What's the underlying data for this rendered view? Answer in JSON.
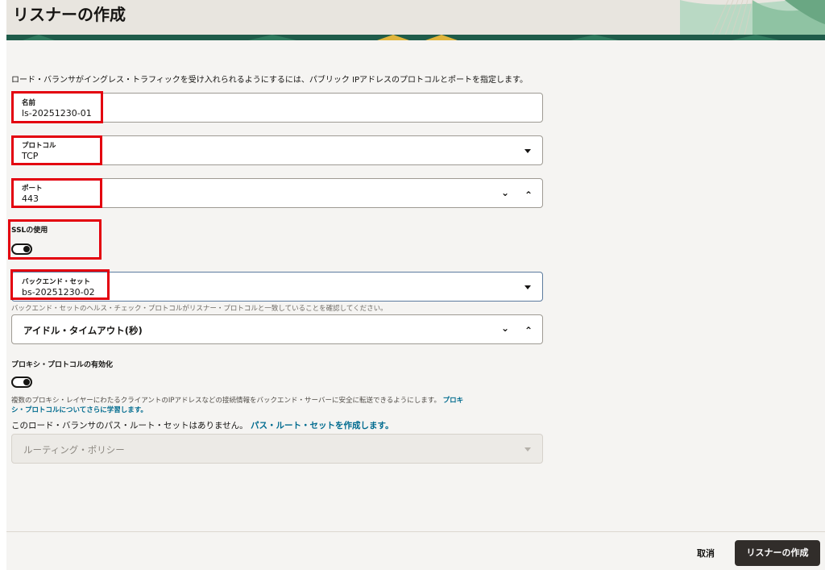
{
  "header": {
    "title": "リスナーの作成"
  },
  "intro": "ロード・バランサがイングレス・トラフィックを受け入れられるようにするには、パブリック IPアドレスのプロトコルとポートを指定します。",
  "form": {
    "name": {
      "label": "名前",
      "value": "ls-20251230-01"
    },
    "protocol": {
      "label": "プロトコル",
      "value": "TCP"
    },
    "port": {
      "label": "ポート",
      "value": "443"
    },
    "ssl": {
      "label": "SSLの使用",
      "enabled": false
    },
    "backend_set": {
      "label": "バックエンド・セット",
      "value": "bs-20251230-02",
      "helper": "バックエンド・セットのヘルス・チェック・プロトコルがリスナー・プロトコルと一致していることを確認してください。"
    },
    "idle_timeout": {
      "placeholder": "アイドル・タイムアウト(秒)"
    },
    "proxy_protocol": {
      "label": "プロキシ・プロトコルの有効化",
      "enabled": false,
      "helper_text": "複数のプロキシ・レイヤーにわたるクライアントのIPアドレスなどの接続情報をバックエンド・サーバーに安全に転送できるようにします。",
      "helper_link_part1": "プロキ",
      "helper_link_part2": "シ・プロトコルについてさらに学習します。"
    },
    "route_set": {
      "text": "このロード・バランサのパス・ルート・セットはありません。",
      "link": "パス・ルート・セットを作成します。"
    },
    "routing_policy": {
      "placeholder": "ルーティング・ポリシー",
      "disabled": true
    }
  },
  "footer": {
    "cancel_label": "取消",
    "submit_label": "リスナーの作成"
  },
  "colors": {
    "primary_button": "#312d2a",
    "highlight": "#e3000f",
    "link": "#006b8f"
  }
}
